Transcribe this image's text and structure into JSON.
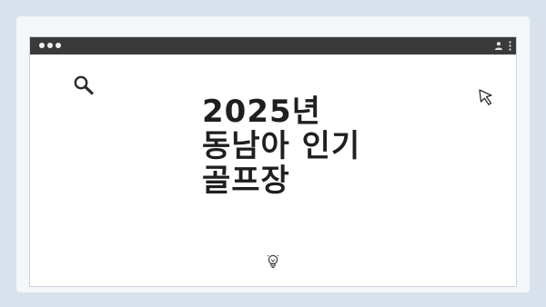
{
  "slide": {
    "title_lines": [
      "2025년",
      "동남아 인기",
      "골프장"
    ]
  },
  "icons": {
    "search": "search-icon",
    "cursor": "cursor-icon",
    "bulb": "lightbulb-icon",
    "user": "user-icon",
    "menu": "more-vertical-icon"
  },
  "colors": {
    "background": "#d9e2ec",
    "titlebar": "#3a3a3a",
    "title_text": "#1f1f1f"
  }
}
